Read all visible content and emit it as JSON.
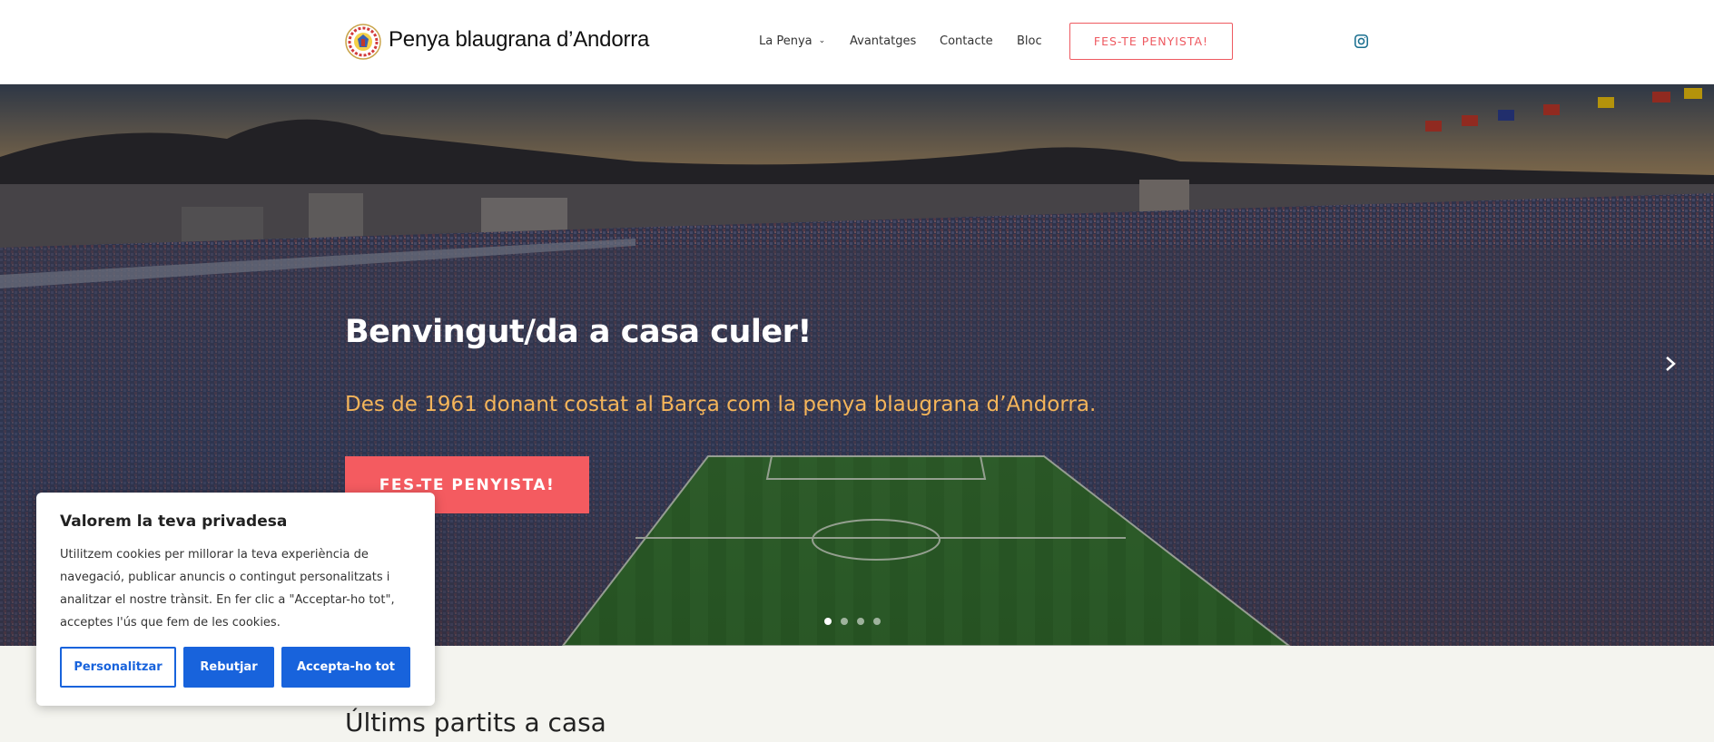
{
  "header": {
    "site_title": "Penya blaugrana d’Andorra",
    "nav": {
      "la_penya": "La Penya",
      "avantatges": "Avantatges",
      "contacte": "Contacte",
      "bloc": "Bloc"
    },
    "cta": "FES-TE PENYISTA!"
  },
  "hero": {
    "title": "Benvingut/da a casa culer!",
    "subtitle": "Des de 1961 donant costat al Barça com la penya blaugrana d’Andorra.",
    "cta": "FES-TE PENYISTA!",
    "slides_total": 4,
    "slide_active": 1
  },
  "section": {
    "title": "Últims partits a casa"
  },
  "cookie": {
    "title": "Valorem la teva privadesa",
    "text": "Utilitzem cookies per millorar la teva experiència de navegació, publicar anuncis o contingut personalitzats i analitzar el nostre trànsit. En fer clic a \"Acceptar-ho tot\", acceptes l'ús que fem de les cookies.",
    "customize": "Personalitzar",
    "reject": "Rebutjar",
    "accept": "Accepta-ho tot"
  },
  "colors": {
    "accent": "#f45b60",
    "subtitle": "#f4b55a",
    "cookie_button": "#1863dc"
  },
  "icons": {
    "instagram": "instagram-icon",
    "next": "chevron-right-icon",
    "dropdown": "chevron-down-icon"
  }
}
